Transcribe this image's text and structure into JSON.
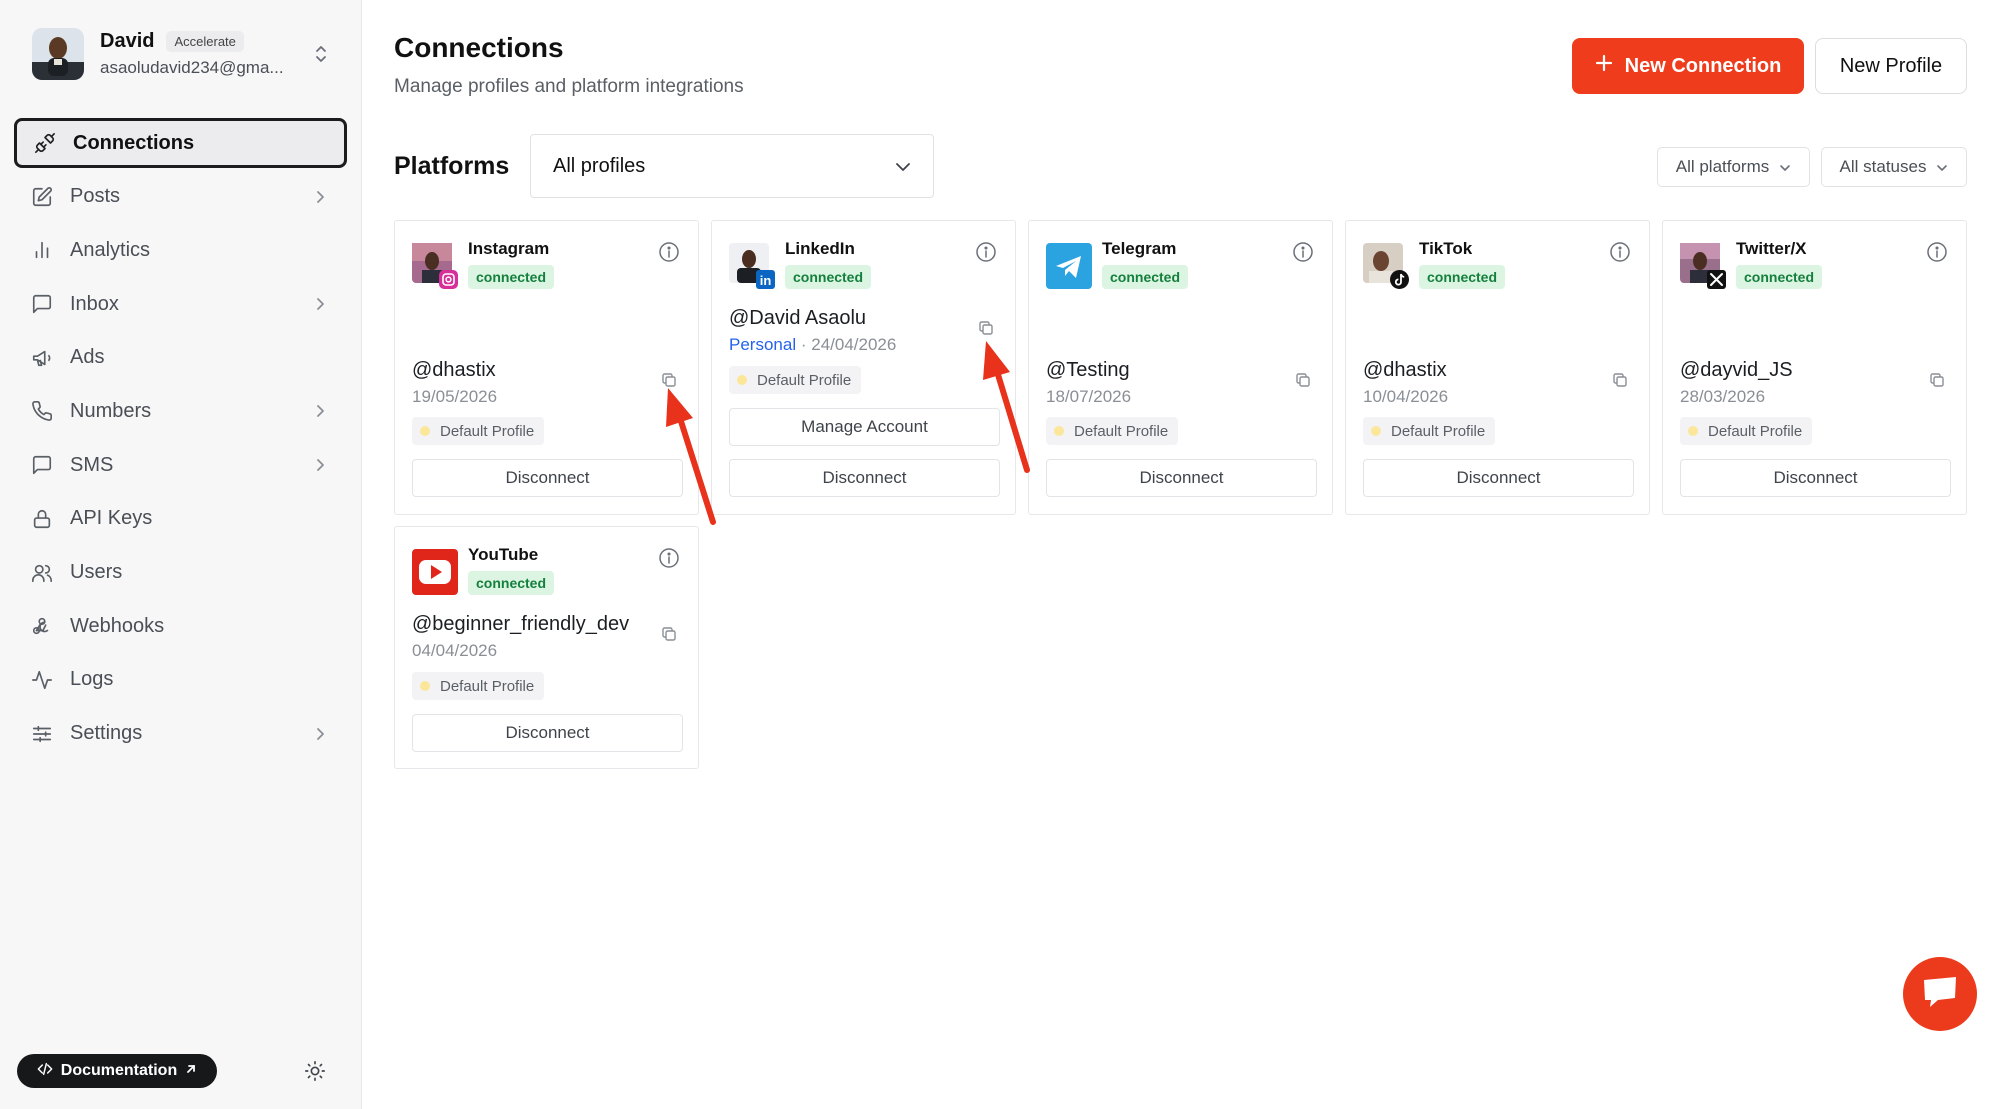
{
  "user": {
    "name": "David",
    "plan": "Accelerate",
    "email": "asaoludavid234@gma..."
  },
  "nav": {
    "items": [
      {
        "label": "Connections",
        "icon": "plug-icon",
        "active": true,
        "has_chevron": false
      },
      {
        "label": "Posts",
        "icon": "edit-icon",
        "active": false,
        "has_chevron": true
      },
      {
        "label": "Analytics",
        "icon": "bar-chart-icon",
        "active": false,
        "has_chevron": false
      },
      {
        "label": "Inbox",
        "icon": "message-square-icon",
        "active": false,
        "has_chevron": true
      },
      {
        "label": "Ads",
        "icon": "megaphone-icon",
        "active": false,
        "has_chevron": false
      },
      {
        "label": "Numbers",
        "icon": "phone-icon",
        "active": false,
        "has_chevron": true
      },
      {
        "label": "SMS",
        "icon": "chat-icon",
        "active": false,
        "has_chevron": true
      },
      {
        "label": "API Keys",
        "icon": "lock-icon",
        "active": false,
        "has_chevron": false
      },
      {
        "label": "Users",
        "icon": "users-icon",
        "active": false,
        "has_chevron": false
      },
      {
        "label": "Webhooks",
        "icon": "webhook-icon",
        "active": false,
        "has_chevron": false
      },
      {
        "label": "Logs",
        "icon": "activity-icon",
        "active": false,
        "has_chevron": false
      },
      {
        "label": "Settings",
        "icon": "sliders-icon",
        "active": false,
        "has_chevron": true
      }
    ]
  },
  "footer": {
    "docs_label": "Documentation"
  },
  "header": {
    "title": "Connections",
    "subtitle": "Manage profiles and platform integrations",
    "new_connection_label": "New Connection",
    "new_profile_label": "New Profile"
  },
  "platforms": {
    "title": "Platforms",
    "profile_select_value": "All profiles",
    "filter_platforms": "All platforms",
    "filter_statuses": "All statuses"
  },
  "cards": [
    {
      "platform": "Instagram",
      "status": "connected",
      "handle": "@dhastix",
      "date": "19/05/2026",
      "profile": "Default Profile",
      "button": "Disconnect",
      "icon": "instagram-icon"
    },
    {
      "platform": "LinkedIn",
      "status": "connected",
      "handle": "@David Asaolu",
      "account_type": "Personal",
      "separator": "·",
      "date": "24/04/2026",
      "profile": "Default Profile",
      "manage_button": "Manage Account",
      "button": "Disconnect",
      "icon": "linkedin-icon"
    },
    {
      "platform": "Telegram",
      "status": "connected",
      "handle": "@Testing",
      "date": "18/07/2026",
      "profile": "Default Profile",
      "button": "Disconnect",
      "icon": "telegram-icon"
    },
    {
      "platform": "TikTok",
      "status": "connected",
      "handle": "@dhastix",
      "date": "10/04/2026",
      "profile": "Default Profile",
      "button": "Disconnect",
      "icon": "tiktok-icon"
    },
    {
      "platform": "Twitter/X",
      "status": "connected",
      "handle": "@dayvid_JS",
      "date": "28/03/2026",
      "profile": "Default Profile",
      "button": "Disconnect",
      "icon": "x-icon"
    },
    {
      "platform": "YouTube",
      "status": "connected",
      "handle": "@beginner_friendly_dev",
      "date": "04/04/2026",
      "profile": "Default Profile",
      "button": "Disconnect",
      "icon": "youtube-icon"
    }
  ],
  "colors": {
    "accent": "#ee3c1c",
    "connected_bg": "#dcf5e3",
    "connected_text": "#15803d",
    "annotation_arrow": "#e8321b"
  }
}
